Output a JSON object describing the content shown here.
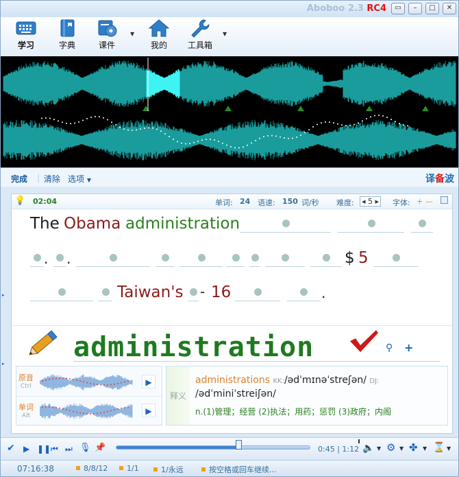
{
  "window": {
    "title": "Aboboo 2.3",
    "title_suffix": "RC4",
    "controls": [
      "restore",
      "minimize",
      "maximize",
      "close"
    ]
  },
  "toolbar": {
    "items": [
      {
        "label": "学习",
        "icon": "keyboard-icon"
      },
      {
        "label": "字典",
        "icon": "dictionary-book-icon"
      },
      {
        "label": "课件",
        "icon": "courseware-disc-icon",
        "has_dropdown": true
      },
      {
        "label": "我的",
        "icon": "home-icon"
      },
      {
        "label": "工具箱",
        "icon": "wrench-icon",
        "has_dropdown": true
      }
    ]
  },
  "actions": {
    "done": "完成",
    "clear": "清除",
    "options": "选项",
    "logo_left": "译",
    "logo_mid": "备",
    "logo_right": "波"
  },
  "infobar": {
    "elapsed": "02:04",
    "words_label": "单词:",
    "words": "24",
    "speed_label": "语速:",
    "speed": "150",
    "speed_unit": "词/秒",
    "difficulty_label": "难度:",
    "difficulty": "5",
    "font_label": "字体:",
    "font_plus": "+",
    "font_minus": "—"
  },
  "sentence": {
    "w_the": "The",
    "w_obama": "Obama",
    "w_admin": "administration",
    "w_dollar": "$",
    "w_five": "5",
    "w_taiwans": "Taiwan's",
    "w_sixteen": "16",
    "p_dot1": ".",
    "p_dot2": ".",
    "p_dash": "-",
    "p_end": "."
  },
  "current_word": "administration",
  "audio": {
    "original_label": "原音",
    "original_key": "Ctrl",
    "word_label": "单词",
    "word_key": "Alt"
  },
  "definition": {
    "side_label": "释义",
    "headword": "administrations",
    "kk_tag": "KK:",
    "kk": "/ədˈmɪnəˈstreʃən/",
    "dj_tag": "DJ:",
    "dj": "/ədˈminiˈstreiʃən/",
    "meaning": "n.(1)管理；经营 (2)执法；用药；惩罚 (3)政府；内阁"
  },
  "player": {
    "position": "0:45",
    "duration": "1:12",
    "progress": 0.62
  },
  "status": {
    "time": "07:16:38",
    "date": "8/8/12",
    "count": "1/1",
    "repeat": "1/永远",
    "hint": "按空格或回车继续..."
  },
  "colors": {
    "accent": "#1b64c4",
    "waveform": "#1a9c9c",
    "waveform_highlight": "#3ff3f3",
    "known_word": "#2a7f1e",
    "entered_word": "#8b1c1c"
  }
}
